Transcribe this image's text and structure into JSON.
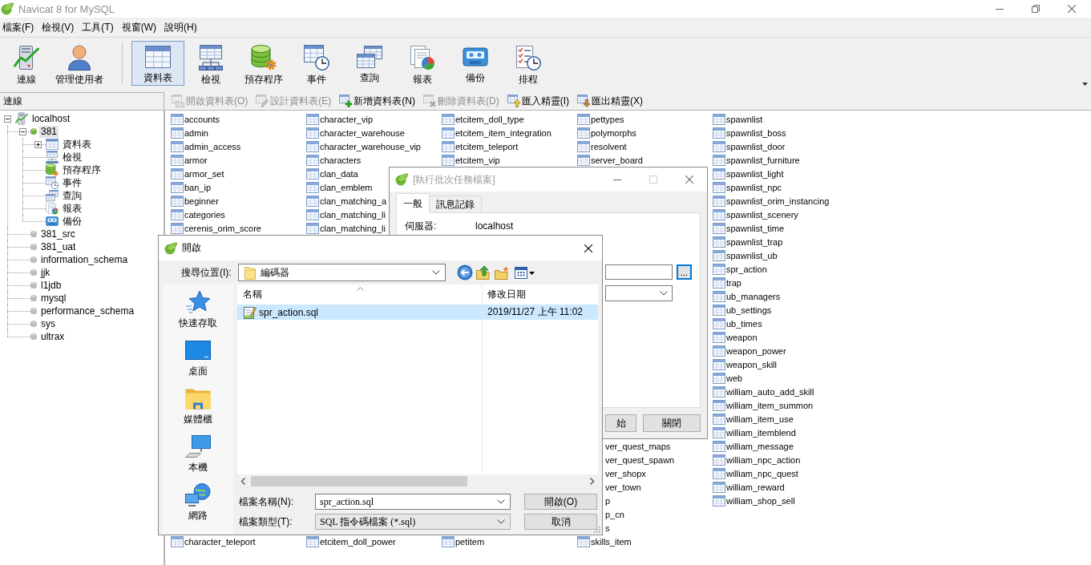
{
  "window": {
    "title": "Navicat 8 for MySQL",
    "active": false
  },
  "menu": [
    "檔案(F)",
    "檢視(V)",
    "工具(T)",
    "視窗(W)",
    "說明(H)"
  ],
  "toolbar": {
    "groups": [
      [
        {
          "label": "連線",
          "kind": "connection",
          "selected": false
        },
        {
          "label": "管理使用者",
          "kind": "user",
          "selected": false
        }
      ],
      [
        {
          "label": "資料表",
          "kind": "table",
          "selected": true
        },
        {
          "label": "檢視",
          "kind": "view",
          "selected": false
        },
        {
          "label": "預存程序",
          "kind": "procedure",
          "selected": false
        },
        {
          "label": "事件",
          "kind": "event",
          "selected": false
        },
        {
          "label": "查詢",
          "kind": "query",
          "selected": false
        },
        {
          "label": "報表",
          "kind": "report",
          "selected": false
        },
        {
          "label": "備份",
          "kind": "backup",
          "selected": false
        },
        {
          "label": "排程",
          "kind": "schedule",
          "selected": false
        }
      ]
    ]
  },
  "sidebar": {
    "header": "連線",
    "tree": [
      {
        "label": "localhost",
        "kind": "server",
        "expanded": true,
        "selected": false,
        "children": [
          {
            "label": "381",
            "kind": "database",
            "open": true,
            "expanded": true,
            "selected": true,
            "children": [
              {
                "label": "資料表",
                "kind": "tables",
                "expanded": false,
                "selected": false
              },
              {
                "label": "檢視",
                "kind": "views",
                "selected": false
              },
              {
                "label": "預存程序",
                "kind": "procedures",
                "selected": false
              },
              {
                "label": "事件",
                "kind": "events",
                "selected": false
              },
              {
                "label": "查詢",
                "kind": "queries",
                "selected": false
              },
              {
                "label": "報表",
                "kind": "reports",
                "selected": false
              },
              {
                "label": "備份",
                "kind": "backups",
                "selected": false
              }
            ]
          },
          {
            "label": "381_src",
            "kind": "database",
            "open": false,
            "selected": false
          },
          {
            "label": "381_uat",
            "kind": "database",
            "open": false,
            "selected": false
          },
          {
            "label": "information_schema",
            "kind": "database",
            "open": false,
            "selected": false
          },
          {
            "label": "jjk",
            "kind": "database",
            "open": false,
            "selected": false
          },
          {
            "label": "l1jdb",
            "kind": "database",
            "open": false,
            "selected": false
          },
          {
            "label": "mysql",
            "kind": "database",
            "open": false,
            "selected": false
          },
          {
            "label": "performance_schema",
            "kind": "database",
            "open": false,
            "selected": false
          },
          {
            "label": "sys",
            "kind": "database",
            "open": false,
            "selected": false
          },
          {
            "label": "ultrax",
            "kind": "database",
            "open": false,
            "selected": false
          }
        ]
      }
    ]
  },
  "object_toolbar": [
    {
      "label": "開啟資料表(O)",
      "kind": "open",
      "disabled": true
    },
    {
      "label": "設計資料表(E)",
      "kind": "design",
      "disabled": true
    },
    {
      "label": "新增資料表(N)",
      "kind": "new",
      "disabled": false
    },
    {
      "label": "刪除資料表(D)",
      "kind": "delete",
      "disabled": true
    },
    {
      "label": "匯入精靈(I)",
      "kind": "import",
      "disabled": false
    },
    {
      "label": "匯出精靈(X)",
      "kind": "export",
      "disabled": false
    }
  ],
  "table_list": {
    "columns": [
      {
        "top": [
          {
            "name": "accounts",
            "kind": "table"
          },
          {
            "name": "admin",
            "kind": "table"
          },
          {
            "name": "admin_access",
            "kind": "table"
          },
          {
            "name": "armor",
            "kind": "table"
          },
          {
            "name": "armor_set",
            "kind": "table"
          },
          {
            "name": "ban_ip",
            "kind": "table"
          },
          {
            "name": "beginner",
            "kind": "table"
          },
          {
            "name": "categories",
            "kind": "table"
          },
          {
            "name": "cerenis_orim_score",
            "kind": "table"
          }
        ],
        "bottom": [
          {
            "name": "character_teleport",
            "kind": "table"
          }
        ]
      },
      {
        "top": [
          {
            "name": "character_vip",
            "kind": "table"
          },
          {
            "name": "character_warehouse",
            "kind": "table"
          },
          {
            "name": "character_warehouse_vip",
            "kind": "table"
          },
          {
            "name": "characters",
            "kind": "table"
          },
          {
            "name": "clan_data",
            "kind": "table"
          },
          {
            "name": "clan_emblem",
            "kind": "table"
          },
          {
            "name": "clan_matching_a",
            "kind": "table"
          },
          {
            "name": "clan_matching_li",
            "kind": "table"
          },
          {
            "name": "clan_matching_li",
            "kind": "table"
          }
        ],
        "bottom": [
          {
            "name": "etcitem_doll_power",
            "kind": "table"
          }
        ]
      },
      {
        "top": [
          {
            "name": "etcitem_doll_type",
            "kind": "table"
          },
          {
            "name": "etcitem_item_integration",
            "kind": "table"
          },
          {
            "name": "etcitem_teleport",
            "kind": "table"
          },
          {
            "name": "etcitem_vip",
            "kind": "table"
          }
        ],
        "bottom": [
          {
            "name": "petitem",
            "kind": "table"
          }
        ]
      },
      {
        "top": [
          {
            "name": "pettypes",
            "kind": "table"
          },
          {
            "name": "polymorphs",
            "kind": "table"
          },
          {
            "name": "resolvent",
            "kind": "table"
          },
          {
            "name": "server_board",
            "kind": "table"
          }
        ],
        "bottom": [
          {
            "name": "ver_quest_maps",
            "kind": "clipped"
          },
          {
            "name": "ver_quest_spawn",
            "kind": "clipped"
          },
          {
            "name": "ver_shopx",
            "kind": "clipped"
          },
          {
            "name": "ver_town",
            "kind": "clipped"
          },
          {
            "name": "p",
            "kind": "clipped"
          },
          {
            "name": "p_cn",
            "kind": "clipped"
          },
          {
            "name": "s",
            "kind": "clipped"
          },
          {
            "name": "skills_item",
            "kind": "table"
          }
        ]
      },
      {
        "top": [
          {
            "name": "spawnlist",
            "kind": "table"
          },
          {
            "name": "spawnlist_boss",
            "kind": "table"
          },
          {
            "name": "spawnlist_door",
            "kind": "table"
          },
          {
            "name": "spawnlist_furniture",
            "kind": "table"
          },
          {
            "name": "spawnlist_light",
            "kind": "table"
          },
          {
            "name": "spawnlist_npc",
            "kind": "table"
          },
          {
            "name": "spawnlist_orim_instancing",
            "kind": "table"
          },
          {
            "name": "spawnlist_scenery",
            "kind": "table"
          },
          {
            "name": "spawnlist_time",
            "kind": "table"
          },
          {
            "name": "spawnlist_trap",
            "kind": "table"
          },
          {
            "name": "spawnlist_ub",
            "kind": "table"
          },
          {
            "name": "spr_action",
            "kind": "table"
          },
          {
            "name": "trap",
            "kind": "table"
          },
          {
            "name": "ub_managers",
            "kind": "table"
          },
          {
            "name": "ub_settings",
            "kind": "table"
          },
          {
            "name": "ub_times",
            "kind": "table"
          },
          {
            "name": "weapon",
            "kind": "table"
          },
          {
            "name": "weapon_power",
            "kind": "table"
          },
          {
            "name": "weapon_skill",
            "kind": "table"
          },
          {
            "name": "web",
            "kind": "table"
          },
          {
            "name": "william_auto_add_skill",
            "kind": "table"
          },
          {
            "name": "william_item_summon",
            "kind": "table"
          },
          {
            "name": "william_item_use",
            "kind": "table"
          },
          {
            "name": "william_itemblend",
            "kind": "table"
          },
          {
            "name": "william_message",
            "kind": "table"
          },
          {
            "name": "william_npc_action",
            "kind": "table"
          },
          {
            "name": "william_npc_quest",
            "kind": "table"
          },
          {
            "name": "william_reward",
            "kind": "table"
          },
          {
            "name": "william_shop_sell",
            "kind": "table"
          }
        ]
      }
    ]
  },
  "batch_dialog": {
    "title": "[執行批次任務檔案]",
    "active": false,
    "tabs": [
      {
        "label": "一般",
        "selected": true
      },
      {
        "label": "訊息記錄",
        "selected": false
      }
    ],
    "server_label": "伺服器:",
    "server_value": "localhost",
    "browse_button": {
      "label": "...",
      "focused": true
    },
    "buttons": [
      "始",
      "關閉"
    ]
  },
  "open_dialog": {
    "title": "開啟",
    "active": true,
    "look_in_label": "搜尋位置(I):",
    "look_in_value": "編碼器",
    "places": [
      {
        "label": "快速存取",
        "kind": "quick"
      },
      {
        "label": "桌面",
        "kind": "desktop"
      },
      {
        "label": "媒體櫃",
        "kind": "library"
      },
      {
        "label": "本機",
        "kind": "computer"
      },
      {
        "label": "網路",
        "kind": "network"
      }
    ],
    "columns": [
      "名稱",
      "修改日期"
    ],
    "files": [
      {
        "name": "spr_action.sql",
        "modified": "2019/11/27 上午 11:02",
        "selected": true
      }
    ],
    "file_name_label": "檔案名稱(N):",
    "file_name": "spr_action.sql",
    "file_type_label": "檔案類型(T):",
    "file_type": "SQL 指令碼檔案 (*.sql)",
    "buttons": [
      "開啟(O)",
      "取消"
    ]
  }
}
